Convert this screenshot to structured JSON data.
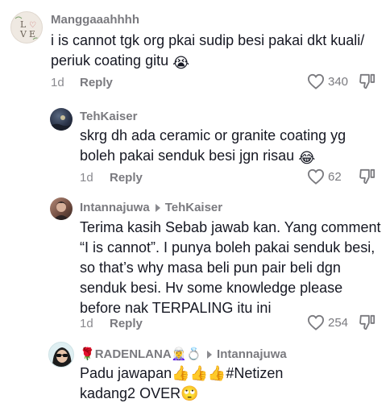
{
  "comments": [
    {
      "username": "Manggaaahhhh",
      "text": "i is cannot tgk org pkai sudip besi pakai dkt kuali/ periuk coating gitu",
      "emoji": "😭",
      "time": "1d",
      "reply_label": "Reply",
      "likes": "340",
      "avatar_text": "L O V E"
    },
    {
      "username": "TehKaiser",
      "text": "skrg dh ada ceramic or granite coating yg boleh pakai senduk besi jgn risau",
      "emoji": "😂",
      "time": "1d",
      "reply_label": "Reply",
      "likes": "62"
    },
    {
      "username": "Intannajuwa",
      "reply_to": "TehKaiser",
      "text": "Terima kasih Sebab jawab kan. Yang comment “I is cannot”. I punya boleh pakai senduk besi, so that’s why masa beli pun pair beli dgn senduk besi. Hv some knowledge please before nak TERPALING itu ini",
      "time": "1d",
      "reply_label": "Reply",
      "likes": "254"
    },
    {
      "username_prefix": "🌹",
      "username": "RADENLANA",
      "username_suffix": "🧝‍♀️💍",
      "reply_to": "Intannajuwa",
      "text": "Padu jawapan👍👍👍#Netizen kadang2 OVER🙄"
    }
  ],
  "colors": {
    "text": "#161823",
    "secondary": "#7a7a7f"
  }
}
